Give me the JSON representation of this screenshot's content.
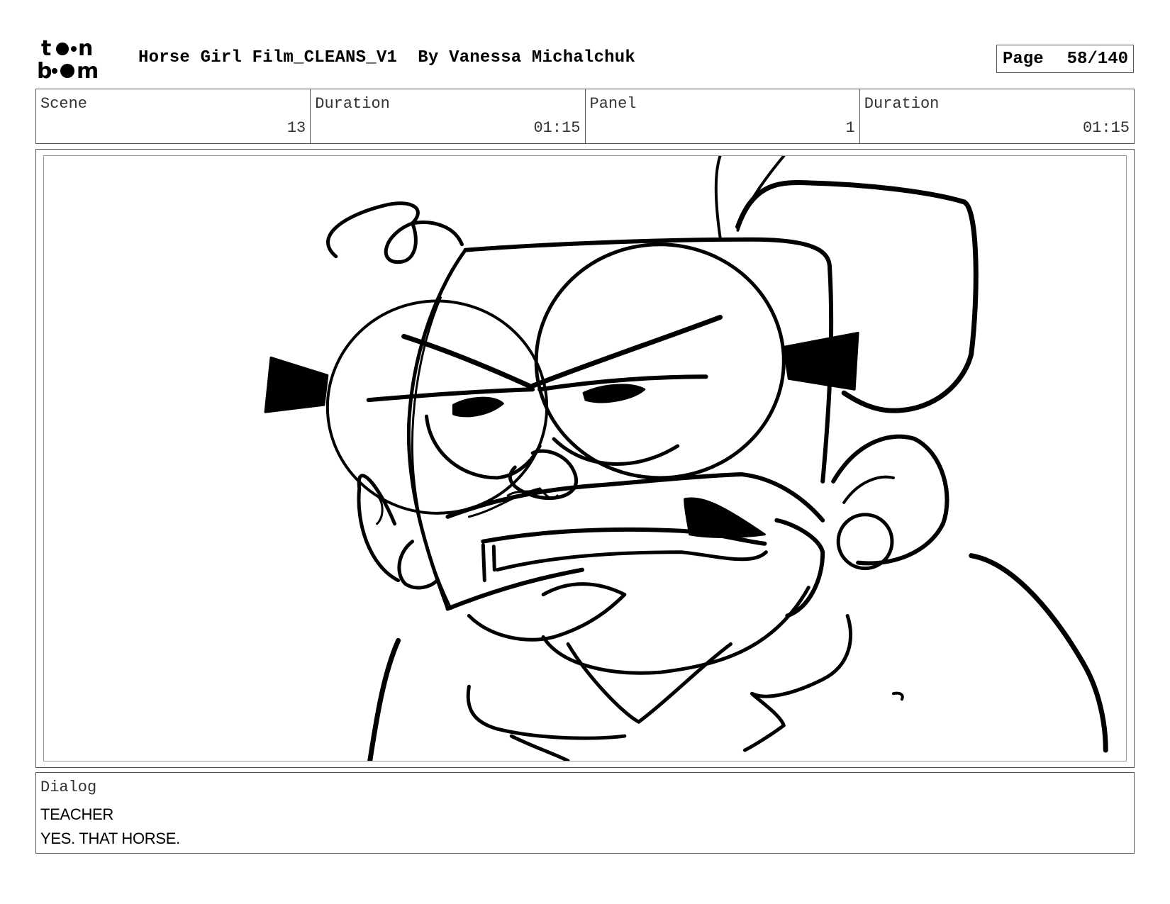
{
  "logo": {
    "line1": "toon",
    "line2": "boom",
    "icon": "toon-boom-logo"
  },
  "header": {
    "title": "Horse Girl Film_CLEANS_V1",
    "author": "By Vanessa Michalchuk",
    "page_label": "Page",
    "page_value": "58/140"
  },
  "info": {
    "scene_label": "Scene",
    "scene_value": "13",
    "duration_label": "Duration",
    "duration_value": "01:15",
    "panel_label": "Panel",
    "panel_value": "1",
    "panel_duration_label": "Duration",
    "panel_duration_value": "01:15"
  },
  "panel": {
    "illustration": "angry-teacher-sketch"
  },
  "dialog": {
    "label": "Dialog",
    "speaker": "TEACHER",
    "line": "YES. THAT HORSE."
  }
}
